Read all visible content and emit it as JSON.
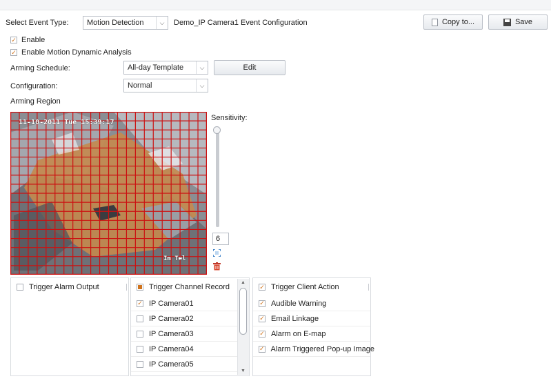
{
  "toolbar": {
    "event_type_label": "Select Event Type:",
    "event_type_value": "Motion Detection",
    "config_title": "Demo_IP Camera1 Event Configuration",
    "copy_label": "Copy to...",
    "save_label": "Save"
  },
  "options": {
    "enable_label": "Enable",
    "enable_checked": true,
    "dynamic_label": "Enable Motion Dynamic Analysis",
    "dynamic_checked": true
  },
  "arming_schedule": {
    "label": "Arming Schedule:",
    "value": "All-day Template",
    "edit_label": "Edit"
  },
  "configuration": {
    "label": "Configuration:",
    "value": "Normal"
  },
  "arming_region": {
    "label": "Arming Region",
    "osd_timestamp": "11-10-2011 Tue 15:39:17",
    "osd_camera": "Im Tel"
  },
  "sensitivity": {
    "label": "Sensitivity:",
    "value": "6",
    "max": 6
  },
  "panels": {
    "alarm_output": {
      "label": "Trigger Alarm Output",
      "checked": false
    },
    "channel_record": {
      "label": "Trigger Channel Record",
      "state": "partial",
      "items": [
        {
          "label": "IP Camera01",
          "checked": true
        },
        {
          "label": "IP Camera02",
          "checked": false
        },
        {
          "label": "IP Camera03",
          "checked": false
        },
        {
          "label": "IP Camera04",
          "checked": false
        },
        {
          "label": "IP Camera05",
          "checked": false
        }
      ]
    },
    "client_action": {
      "label": "Trigger Client Action",
      "checked": true,
      "items": [
        {
          "label": "Audible Warning",
          "checked": true
        },
        {
          "label": "Email Linkage",
          "checked": true
        },
        {
          "label": "Alarm on E-map",
          "checked": true
        },
        {
          "label": "Alarm Triggered Pop-up Image",
          "checked": true
        }
      ]
    }
  },
  "colors": {
    "accent": "#d0731c",
    "grid": "#cc1111",
    "video_base": "#8a8e94",
    "motion_fill": "#c48a4e"
  },
  "icons": {
    "copy": "copy-icon",
    "save": "floppy-disk-icon",
    "fullscreen": "fullscreen-icon",
    "delete": "trash-icon"
  }
}
